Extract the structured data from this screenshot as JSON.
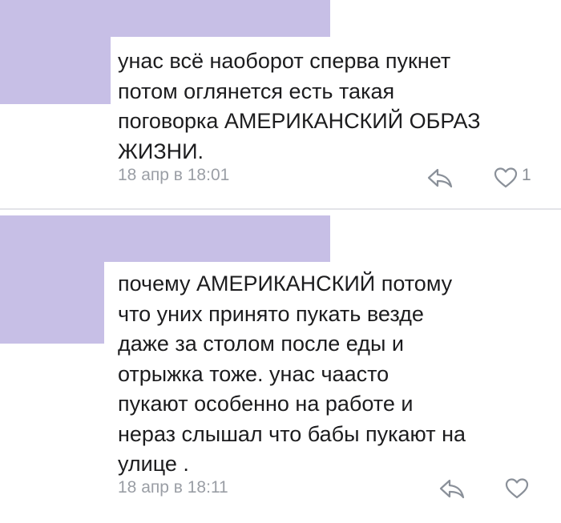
{
  "comments": [
    {
      "text": "унас всё наоборот сперва пукнет\nпотом оглянется есть такая\nпоговорка АМЕРИКАНСКИЙ ОБРАЗ\nЖИЗНИ.",
      "timestamp": "18 апр в 18:01",
      "likes": "1",
      "reply_icon": "reply-arrow-icon",
      "like_icon": "heart-outline-icon"
    },
    {
      "text": "почему АМЕРИКАНСКИЙ потому\nчто уних принято пукать везде\nдаже за столом после еды и\nотрыжка тоже. унас чаасто\nпукают особенно на работе и\nнераз слышал что бабы пукают на\nулице .",
      "timestamp": "18 апр в 18:11",
      "reply_icon": "reply-arrow-icon",
      "like_icon": "heart-outline-icon"
    }
  ],
  "colors": {
    "redaction": "#c7bfe6",
    "text": "#1c1c1e",
    "meta": "#9a9ea5",
    "icon": "#8a9099",
    "divider": "#e3e4e8"
  }
}
